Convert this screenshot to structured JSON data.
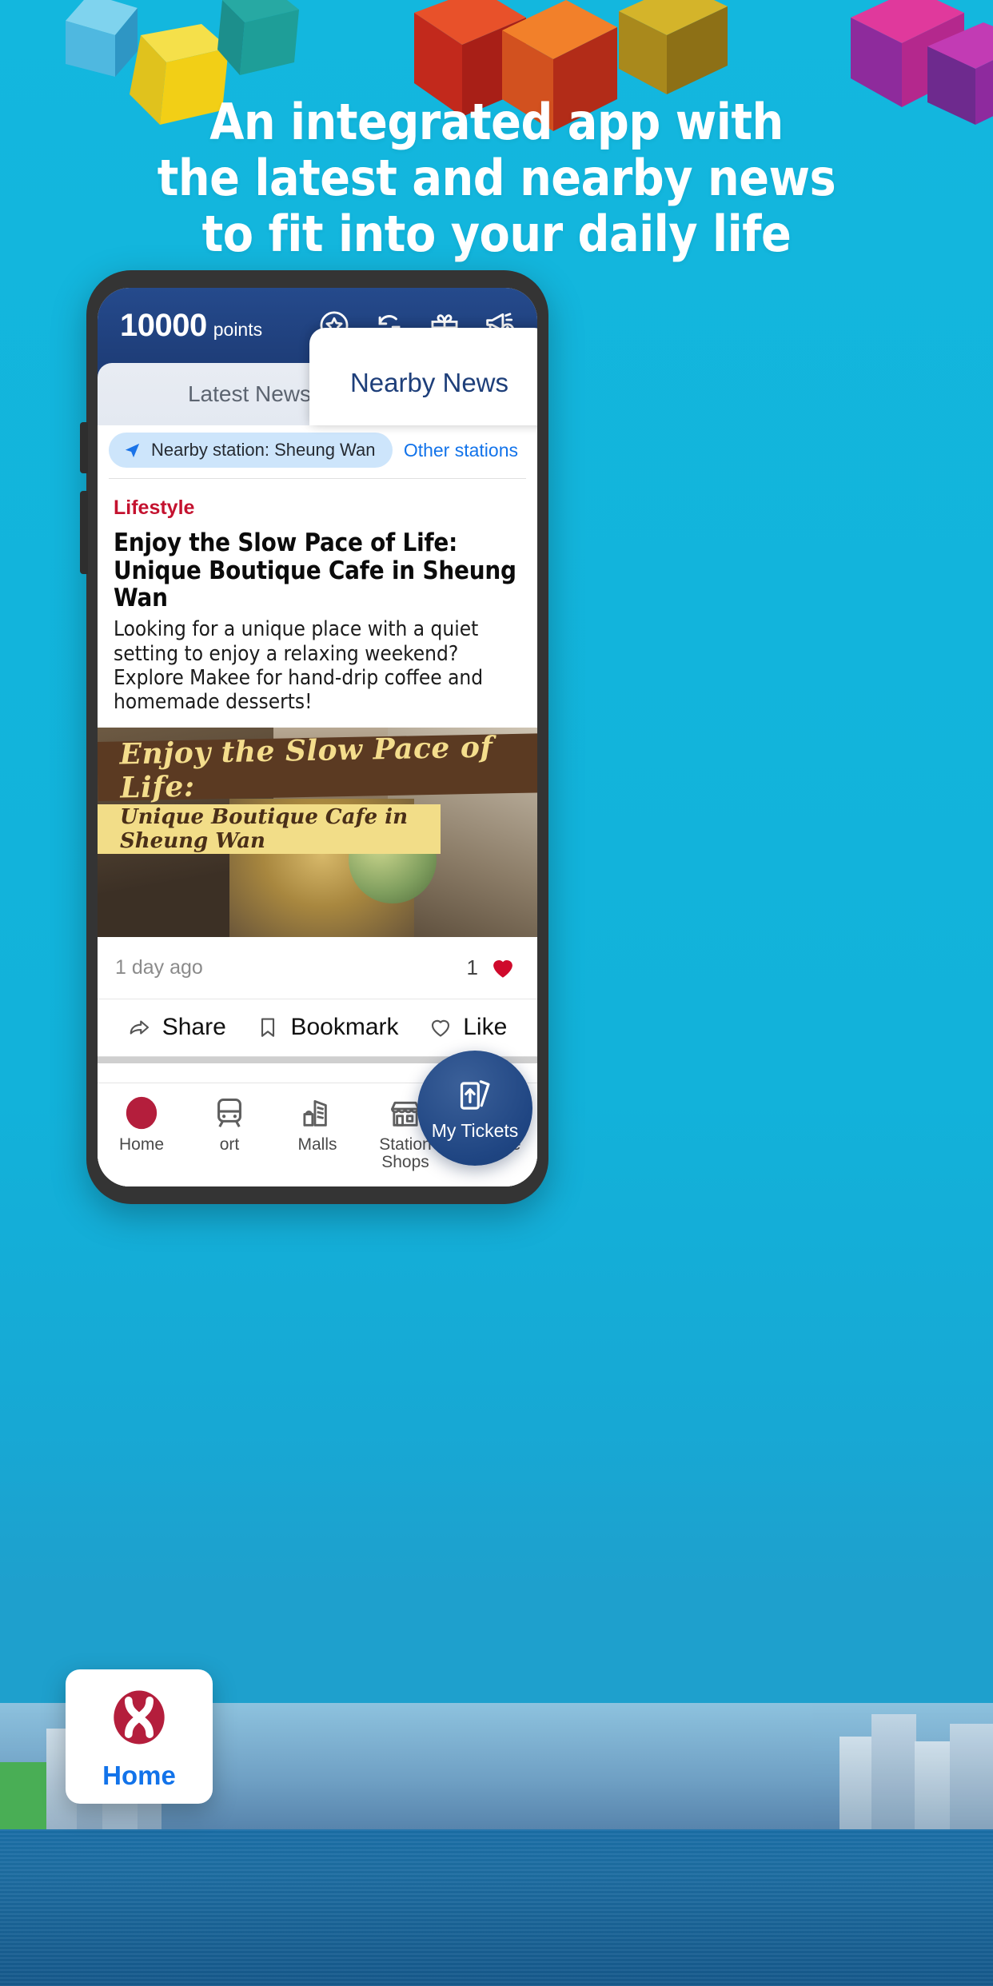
{
  "headline": {
    "line1": "An integrated app with",
    "line2": "the latest and nearby news",
    "line3": "to fit into your daily life"
  },
  "colors": {
    "background": "#11b4db",
    "header_navy": "#1e3d78",
    "accent_blue": "#1273ea",
    "category_red": "#c4122f",
    "heart_red": "#cf0a2c",
    "mtr_red": "#b41e3c"
  },
  "app": {
    "header": {
      "points_value": "10000",
      "points_label": "points",
      "icons": [
        {
          "name": "star-circle-icon"
        },
        {
          "name": "refresh-icon"
        },
        {
          "name": "gift-icon"
        },
        {
          "name": "megaphone-star-icon"
        }
      ]
    },
    "tabs": [
      {
        "label": "Latest News",
        "active": false
      },
      {
        "label": "Nearby News",
        "active": true
      }
    ],
    "station_bar": {
      "chip_label": "Nearby station: Sheung Wan",
      "other_link": "Other stations"
    },
    "article": {
      "category": "Lifestyle",
      "title": "Enjoy the Slow Pace of Life: Unique Boutique Cafe in Sheung Wan",
      "description": "Looking for a unique place with a quiet setting to enjoy a relaxing weekend? Explore Makee for hand-drip coffee and homemade desserts!",
      "hero_banner_line1": "Enjoy the Slow Pace of Life:",
      "hero_banner_line2": "Unique Boutique Cafe in Sheung Wan",
      "timestamp": "1 day ago",
      "like_count": "1",
      "actions": [
        {
          "label": "Share",
          "icon": "share-icon"
        },
        {
          "label": "Bookmark",
          "icon": "bookmark-icon"
        },
        {
          "label": "Like",
          "icon": "heart-outline-icon"
        }
      ]
    },
    "bottom_nav": {
      "items": [
        {
          "label": "Home",
          "icon": "mtr-logo-icon",
          "active": true
        },
        {
          "label": "ort",
          "icon": "transport-icon",
          "active": false
        },
        {
          "label": "Malls",
          "icon": "malls-icon",
          "active": false
        },
        {
          "label": "Station Shops",
          "label_line1": "Station",
          "label_line2": "Shops",
          "icon": "shop-icon",
          "active": false
        },
        {
          "label": "e-Store",
          "icon": "cart-icon",
          "active": false
        }
      ],
      "fab": {
        "label": "My Tickets",
        "icon": "tickets-icon"
      }
    }
  }
}
